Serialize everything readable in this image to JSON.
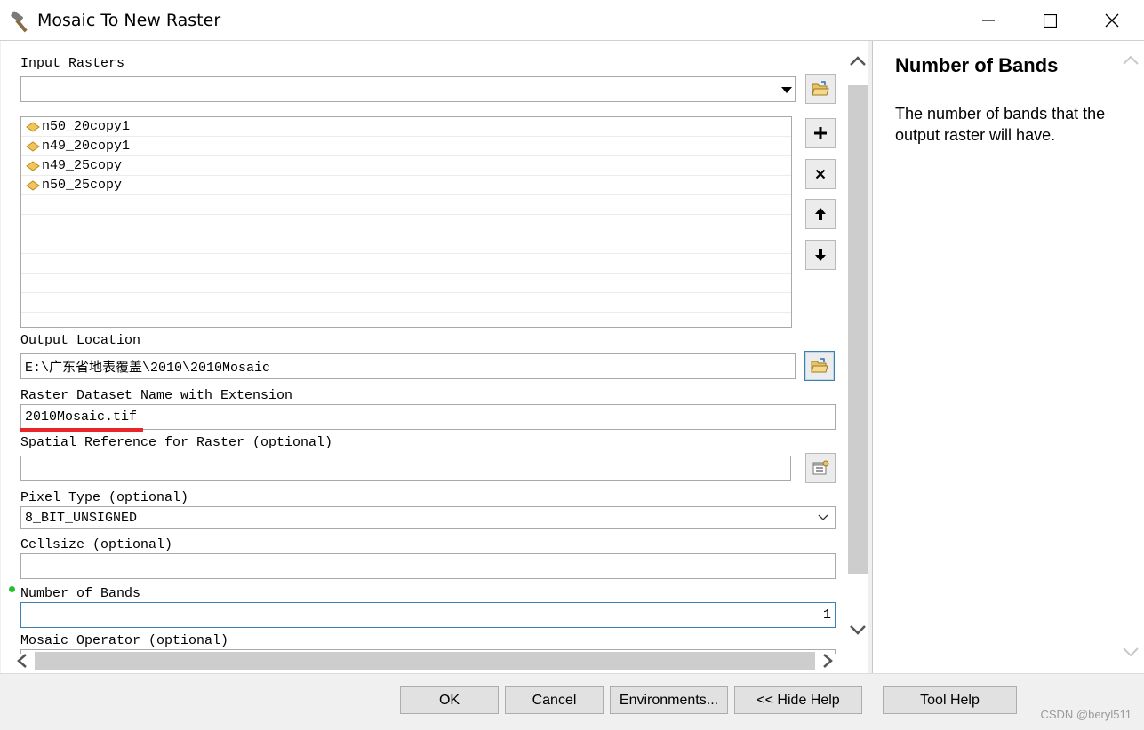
{
  "window": {
    "title": "Mosaic To New Raster",
    "icon": "hammer-icon"
  },
  "form": {
    "input_rasters": {
      "label": "Input Rasters",
      "dropdown_value": "",
      "items": [
        "n50_20copy1",
        "n49_20copy1",
        "n49_25copy",
        "n50_25copy"
      ]
    },
    "output_location": {
      "label": "Output Location",
      "value": "E:\\广东省地表覆盖\\2010\\2010Mosaic"
    },
    "raster_name": {
      "label": "Raster Dataset Name with Extension",
      "value": "2010Mosaic.tif"
    },
    "spatial_reference": {
      "label": "Spatial Reference for Raster (optional)",
      "value": ""
    },
    "pixel_type": {
      "label": "Pixel Type (optional)",
      "value": "8_BIT_UNSIGNED"
    },
    "cellsize": {
      "label": "Cellsize (optional)",
      "value": ""
    },
    "number_of_bands": {
      "label": "Number of Bands",
      "value": "1"
    },
    "mosaic_operator": {
      "label": "Mosaic Operator (optional)"
    }
  },
  "help": {
    "title": "Number of Bands",
    "body": "The number of bands that the output raster will have."
  },
  "buttons": {
    "ok": "OK",
    "cancel": "Cancel",
    "environments": "Environments...",
    "hide_help": "<< Hide Help",
    "tool_help": "Tool Help"
  },
  "watermark": "CSDN @beryl511",
  "colors": {
    "required_dot": "#22c02a",
    "annotation_underline": "#e8262a",
    "focus_border": "#3c7fb1"
  }
}
